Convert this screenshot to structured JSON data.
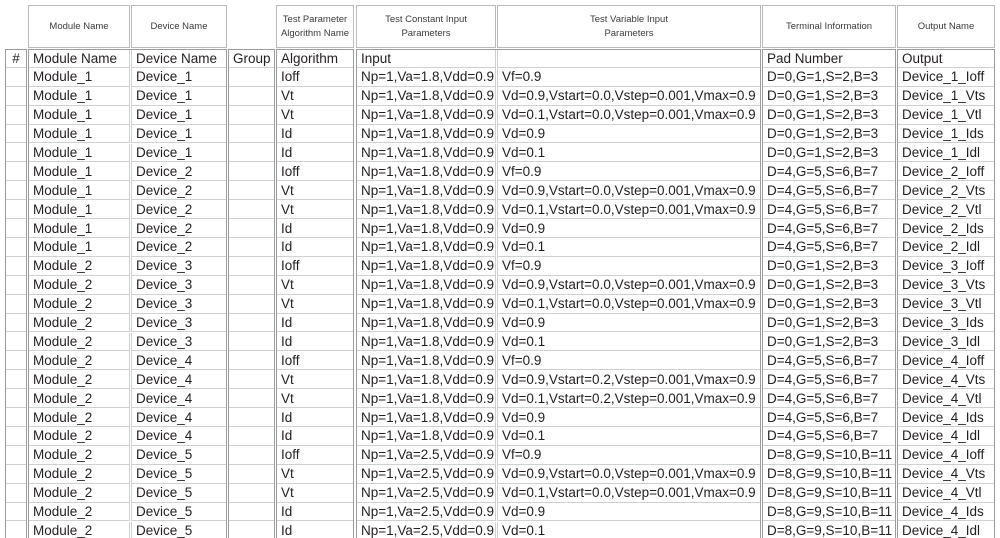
{
  "table": {
    "group_headers": [
      {
        "name": "module-name",
        "lines": [
          "Module Name"
        ]
      },
      {
        "name": "device-name",
        "lines": [
          "Device Name"
        ]
      },
      {
        "name": "test-parameter",
        "lines": [
          "Test Parameter",
          "Algorithm Name"
        ]
      },
      {
        "name": "test-constant",
        "lines": [
          "Test Constant Input",
          "Parameters"
        ]
      },
      {
        "name": "test-variable",
        "lines": [
          "Test Variable Input",
          "Parameters"
        ]
      },
      {
        "name": "terminal-info",
        "lines": [
          "Terminal Information"
        ]
      },
      {
        "name": "output-name",
        "lines": [
          "Output Name"
        ]
      }
    ],
    "columns": [
      {
        "name": "index",
        "label": "#"
      },
      {
        "name": "module-name",
        "label": "Module Name"
      },
      {
        "name": "device-name",
        "label": "Device Name"
      },
      {
        "name": "group",
        "label": "Group"
      },
      {
        "name": "algorithm",
        "label": "Algorithm"
      },
      {
        "name": "input",
        "label": "Input"
      },
      {
        "name": "variable-input",
        "label": ""
      },
      {
        "name": "pad-number",
        "label": "Pad Number"
      },
      {
        "name": "output",
        "label": "Output"
      }
    ],
    "rows": [
      [
        "",
        "Module_1",
        "Device_1",
        "",
        "Ioff",
        "Np=1,Va=1.8,Vdd=0.9",
        "Vf=0.9",
        "D=0,G=1,S=2,B=3",
        "Device_1_Ioff"
      ],
      [
        "",
        "Module_1",
        "Device_1",
        "",
        "Vt",
        "Np=1,Va=1.8,Vdd=0.9",
        "Vd=0.9,Vstart=0.0,Vstep=0.001,Vmax=0.9",
        "D=0,G=1,S=2,B=3",
        "Device_1_Vts"
      ],
      [
        "",
        "Module_1",
        "Device_1",
        "",
        "Vt",
        "Np=1,Va=1.8,Vdd=0.9",
        "Vd=0.1,Vstart=0.0,Vstep=0.001,Vmax=0.9",
        "D=0,G=1,S=2,B=3",
        "Device_1_Vtl"
      ],
      [
        "",
        "Module_1",
        "Device_1",
        "",
        "Id",
        "Np=1,Va=1.8,Vdd=0.9",
        "Vd=0.9",
        "D=0,G=1,S=2,B=3",
        "Device_1_Ids"
      ],
      [
        "",
        "Module_1",
        "Device_1",
        "",
        "Id",
        "Np=1,Va=1.8,Vdd=0.9",
        "Vd=0.1",
        "D=0,G=1,S=2,B=3",
        "Device_1_Idl"
      ],
      [
        "",
        "Module_1",
        "Device_2",
        "",
        "Ioff",
        "Np=1,Va=1.8,Vdd=0.9",
        "Vf=0.9",
        "D=4,G=5,S=6,B=7",
        "Device_2_Ioff"
      ],
      [
        "",
        "Module_1",
        "Device_2",
        "",
        "Vt",
        "Np=1,Va=1.8,Vdd=0.9",
        "Vd=0.9,Vstart=0.0,Vstep=0.001,Vmax=0.9",
        "D=4,G=5,S=6,B=7",
        "Device_2_Vts"
      ],
      [
        "",
        "Module_1",
        "Device_2",
        "",
        "Vt",
        "Np=1,Va=1.8,Vdd=0.9",
        "Vd=0.1,Vstart=0.0,Vstep=0.001,Vmax=0.9",
        "D=4,G=5,S=6,B=7",
        "Device_2_Vtl"
      ],
      [
        "",
        "Module_1",
        "Device_2",
        "",
        "Id",
        "Np=1,Va=1.8,Vdd=0.9",
        "Vd=0.9",
        "D=4,G=5,S=6,B=7",
        "Device_2_Ids"
      ],
      [
        "",
        "Module_1",
        "Device_2",
        "",
        "Id",
        "Np=1,Va=1.8,Vdd=0.9",
        "Vd=0.1",
        "D=4,G=5,S=6,B=7",
        "Device_2_Idl"
      ],
      [
        "",
        "Module_2",
        "Device_3",
        "",
        "Ioff",
        "Np=1,Va=1.8,Vdd=0.9",
        "Vf=0.9",
        "D=0,G=1,S=2,B=3",
        "Device_3_Ioff"
      ],
      [
        "",
        "Module_2",
        "Device_3",
        "",
        "Vt",
        "Np=1,Va=1.8,Vdd=0.9",
        "Vd=0.9,Vstart=0.0,Vstep=0.001,Vmax=0.9",
        "D=0,G=1,S=2,B=3",
        "Device_3_Vts"
      ],
      [
        "",
        "Module_2",
        "Device_3",
        "",
        "Vt",
        "Np=1,Va=1.8,Vdd=0.9",
        "Vd=0.1,Vstart=0.0,Vstep=0.001,Vmax=0.9",
        "D=0,G=1,S=2,B=3",
        "Device_3_Vtl"
      ],
      [
        "",
        "Module_2",
        "Device_3",
        "",
        "Id",
        "Np=1,Va=1.8,Vdd=0.9",
        "Vd=0.9",
        "D=0,G=1,S=2,B=3",
        "Device_3_Ids"
      ],
      [
        "",
        "Module_2",
        "Device_3",
        "",
        "Id",
        "Np=1,Va=1.8,Vdd=0.9",
        "Vd=0.1",
        "D=0,G=1,S=2,B=3",
        "Device_3_Idl"
      ],
      [
        "",
        "Module_2",
        "Device_4",
        "",
        "Ioff",
        "Np=1,Va=1.8,Vdd=0.9",
        "Vf=0.9",
        "D=4,G=5,S=6,B=7",
        "Device_4_Ioff"
      ],
      [
        "",
        "Module_2",
        "Device_4",
        "",
        "Vt",
        "Np=1,Va=1.8,Vdd=0.9",
        "Vd=0.9,Vstart=0.2,Vstep=0.001,Vmax=0.9",
        "D=4,G=5,S=6,B=7",
        "Device_4_Vts"
      ],
      [
        "",
        "Module_2",
        "Device_4",
        "",
        "Vt",
        "Np=1,Va=1.8,Vdd=0.9",
        "Vd=0.1,Vstart=0.2,Vstep=0.001,Vmax=0.9",
        "D=4,G=5,S=6,B=7",
        "Device_4_Vtl"
      ],
      [
        "",
        "Module_2",
        "Device_4",
        "",
        "Id",
        "Np=1,Va=1.8,Vdd=0.9",
        "Vd=0.9",
        "D=4,G=5,S=6,B=7",
        "Device_4_Ids"
      ],
      [
        "",
        "Module_2",
        "Device_4",
        "",
        "Id",
        "Np=1,Va=1.8,Vdd=0.9",
        "Vd=0.1",
        "D=4,G=5,S=6,B=7",
        "Device_4_Idl"
      ],
      [
        "",
        "Module_2",
        "Device_5",
        "",
        "Ioff",
        "Np=1,Va=2.5,Vdd=0.9",
        "Vf=0.9",
        "D=8,G=9,S=10,B=11",
        "Device_4_Ioff"
      ],
      [
        "",
        "Module_2",
        "Device_5",
        "",
        "Vt",
        "Np=1,Va=2.5,Vdd=0.9",
        "Vd=0.9,Vstart=0.0,Vstep=0.001,Vmax=0.9",
        "D=8,G=9,S=10,B=11",
        "Device_4_Vts"
      ],
      [
        "",
        "Module_2",
        "Device_5",
        "",
        "Vt",
        "Np=1,Va=2.5,Vdd=0.9",
        "Vd=0.1,Vstart=0.0,Vstep=0.001,Vmax=0.9",
        "D=8,G=9,S=10,B=11",
        "Device_4_Vtl"
      ],
      [
        "",
        "Module_2",
        "Device_5",
        "",
        "Id",
        "Np=1,Va=2.5,Vdd=0.9",
        "Vd=0.9",
        "D=8,G=9,S=10,B=11",
        "Device_4_Ids"
      ],
      [
        "",
        "Module_2",
        "Device_5",
        "",
        "Id",
        "Np=1,Va=2.5,Vdd=0.9",
        "Vd=0.1",
        "D=8,G=9,S=10,B=11",
        "Device_4_Idl"
      ]
    ]
  },
  "colors": {
    "grid_line": "#cfd2d4",
    "outer_line": "#9a9d9f",
    "header_text": "#3b3b3b",
    "body_text": "#231f20",
    "background": "#ffffff"
  }
}
